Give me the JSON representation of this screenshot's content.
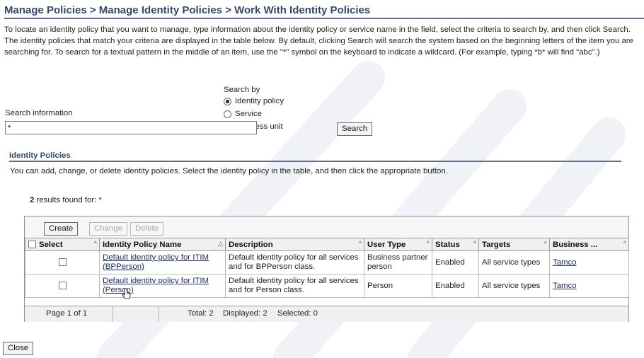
{
  "page": {
    "title": "Manage Policies > Manage Identity Policies > Work With Identity Policies",
    "intro": "To locate an identity policy that you want to manage, type information about the identity policy or service name in the field, select the criteria to search by, and then click Search. The identity policies that match your criteria are displayed in the table below. By default, clicking Search will search the system based on the beginning letters of the item you are searching for. To search for a textual pattern in the middle of an item, use the \"*\" symbol on the keyboard to indicate a wildcard. (For example, typing *b* will find \"abc\".)"
  },
  "search": {
    "info_label": "Search information",
    "value": "*",
    "searchby_label": "Search by",
    "options": [
      {
        "label": "Identity policy",
        "selected": true
      },
      {
        "label": "Service",
        "selected": false
      },
      {
        "label": "Business unit",
        "selected": false
      }
    ],
    "button": "Search"
  },
  "section": {
    "title": "Identity Policies",
    "description": "You can add, change, or delete identity policies. Select the identity policy in the table, and then click the appropriate button."
  },
  "results": {
    "count": "2",
    "text": " results found for: *"
  },
  "toolbar": {
    "create": "Create",
    "change": "Change",
    "delete": "Delete"
  },
  "table": {
    "columns": [
      "Select",
      "Identity Policy Name",
      "Description",
      "User Type",
      "Status",
      "Targets",
      "Business ..."
    ],
    "rows": [
      {
        "name": "Default identity policy for ITIM (BPPerson)",
        "description": "Default identity policy for all services and for BPPerson class.",
        "user_type": "Business partner person",
        "status": "Enabled",
        "targets": "All service types",
        "business_unit": "Tamco"
      },
      {
        "name": "Default identity policy for ITIM (Person)",
        "description": "Default identity policy for all services and for Person class.",
        "user_type": "Person",
        "status": "Enabled",
        "targets": "All service types",
        "business_unit": "Tamco"
      }
    ],
    "footer": {
      "page": "Page 1 of 1",
      "total": "Total: 2",
      "displayed": "Displayed: 2",
      "selected": "Selected: 0"
    }
  },
  "close_button": "Close",
  "colors": {
    "title": "#33476d",
    "rule": "#5c6f92",
    "link": "#1f2f6a",
    "header_bg": "#f0f0f0"
  },
  "icons": {
    "sort_asc": "triangle-up-icon",
    "sort_caret": "caret-up-icon",
    "cursor": "hand-pointer-icon"
  }
}
